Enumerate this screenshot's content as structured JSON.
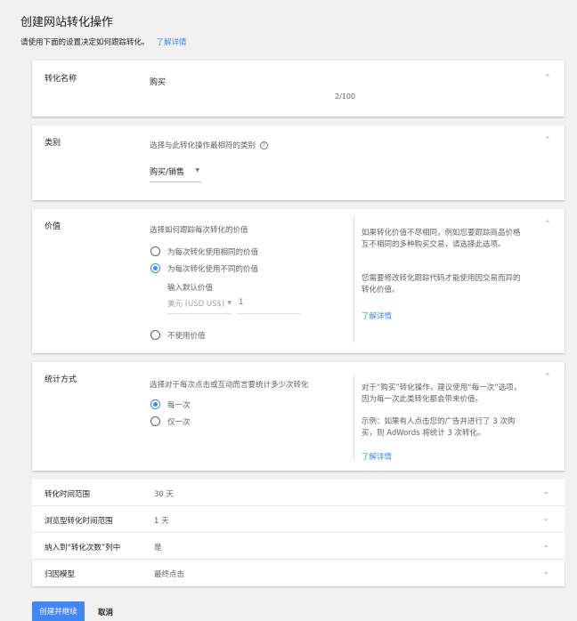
{
  "header": {
    "title": "创建网站转化操作",
    "subtitle": "请使用下面的设置决定如何跟踪转化。",
    "learn_more": "了解详情"
  },
  "conversion_name": {
    "label": "转化名称",
    "value": "购买",
    "counter": "2/100"
  },
  "category": {
    "label": "类别",
    "hint": "选择与此转化操作最相符的类别",
    "value": "购买/销售"
  },
  "value": {
    "label": "价值",
    "hint": "选择如何跟踪每次转化的价值",
    "options": [
      "为每次转化使用相同的价值",
      "为每次转化使用不同的价值",
      "不使用价值"
    ],
    "selected_index": 1,
    "default_label": "输入默认价值",
    "currency": "美元 (USD US$)",
    "default_value": "1",
    "help_p1": "如果转化价值不尽相同，例如您要跟踪商品价格互不相同的多种购买交易，请选择此选项。",
    "help_p2": "您需要修改转化跟踪代码才能使用因交易而异的转化价值。",
    "help_link": "了解详情"
  },
  "counting": {
    "label": "统计方式",
    "hint": "选择对于每次点击或互动而言要统计多少次转化",
    "options": [
      "每一次",
      "仅一次"
    ],
    "selected_index": 0,
    "help_p1": "对于“购买”转化操作，建议使用“每一次”选项，因为每一次此类转化都会带来价值。",
    "help_p2": "示例：如果有人点击您的广告并进行了 3 次购买，则 AdWords 将统计 3 次转化。",
    "help_link": "了解详情"
  },
  "rows": [
    {
      "label": "转化时间范围",
      "value": "30 天"
    },
    {
      "label": "浏览型转化时间范围",
      "value": "1 天"
    },
    {
      "label": "纳入到“转化次数”列中",
      "value": "是"
    },
    {
      "label": "归因模型",
      "value": "最终点击"
    }
  ],
  "actions": {
    "primary": "创建并继续",
    "cancel": "取消"
  },
  "colors": {
    "accent": "#4285f4",
    "background": "#f1f1f1"
  }
}
